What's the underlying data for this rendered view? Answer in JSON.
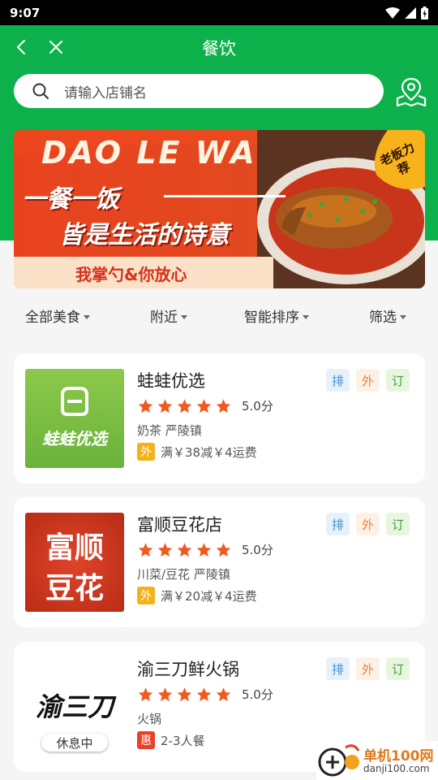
{
  "status_bar": {
    "time": "9:07"
  },
  "header": {
    "title": "餐饮"
  },
  "search": {
    "placeholder": "请输入店铺名"
  },
  "banner": {
    "brand": "DAO LE WA",
    "line1": "一餐一饭",
    "line2": "皆是生活的诗意",
    "slogan": "我掌勺&你放心",
    "badge": "老板力荐"
  },
  "filters": [
    {
      "label": "全部美食"
    },
    {
      "label": "附近"
    },
    {
      "label": "智能排序"
    },
    {
      "label": "筛选"
    }
  ],
  "shops": [
    {
      "name": "蛙蛙优选",
      "rating": 5,
      "score": "5.0分",
      "category": "奶茶  严陵镇",
      "promo_badge": "外",
      "promo_text": "满￥38减￥4运费",
      "logo_text": "蛙蛙优选",
      "tags": [
        "排",
        "外",
        "订"
      ]
    },
    {
      "name": "富顺豆花店",
      "rating": 5,
      "score": "5.0分",
      "category": "川菜/豆花  严陵镇",
      "promo_badge": "外",
      "promo_text": "满￥20减￥4运费",
      "logo_text_1": "富顺",
      "logo_text_2": "豆花",
      "tags": [
        "排",
        "外",
        "订"
      ]
    },
    {
      "name": "渝三刀鲜火锅",
      "rating": 5,
      "score": "5.0分",
      "category": "火锅",
      "promo_badge": "惠",
      "promo_text": "2-3人餐",
      "logo_text": "渝三刀",
      "status": "休息中",
      "tags": [
        "排",
        "外",
        "订"
      ]
    }
  ],
  "watermark": {
    "title": "单机100网",
    "url": "danji100.com"
  },
  "colors": {
    "primary_green": "#0db14b",
    "star_orange": "#f05a22",
    "promo_yellow": "#f3b21b",
    "promo_red": "#e8412b"
  }
}
